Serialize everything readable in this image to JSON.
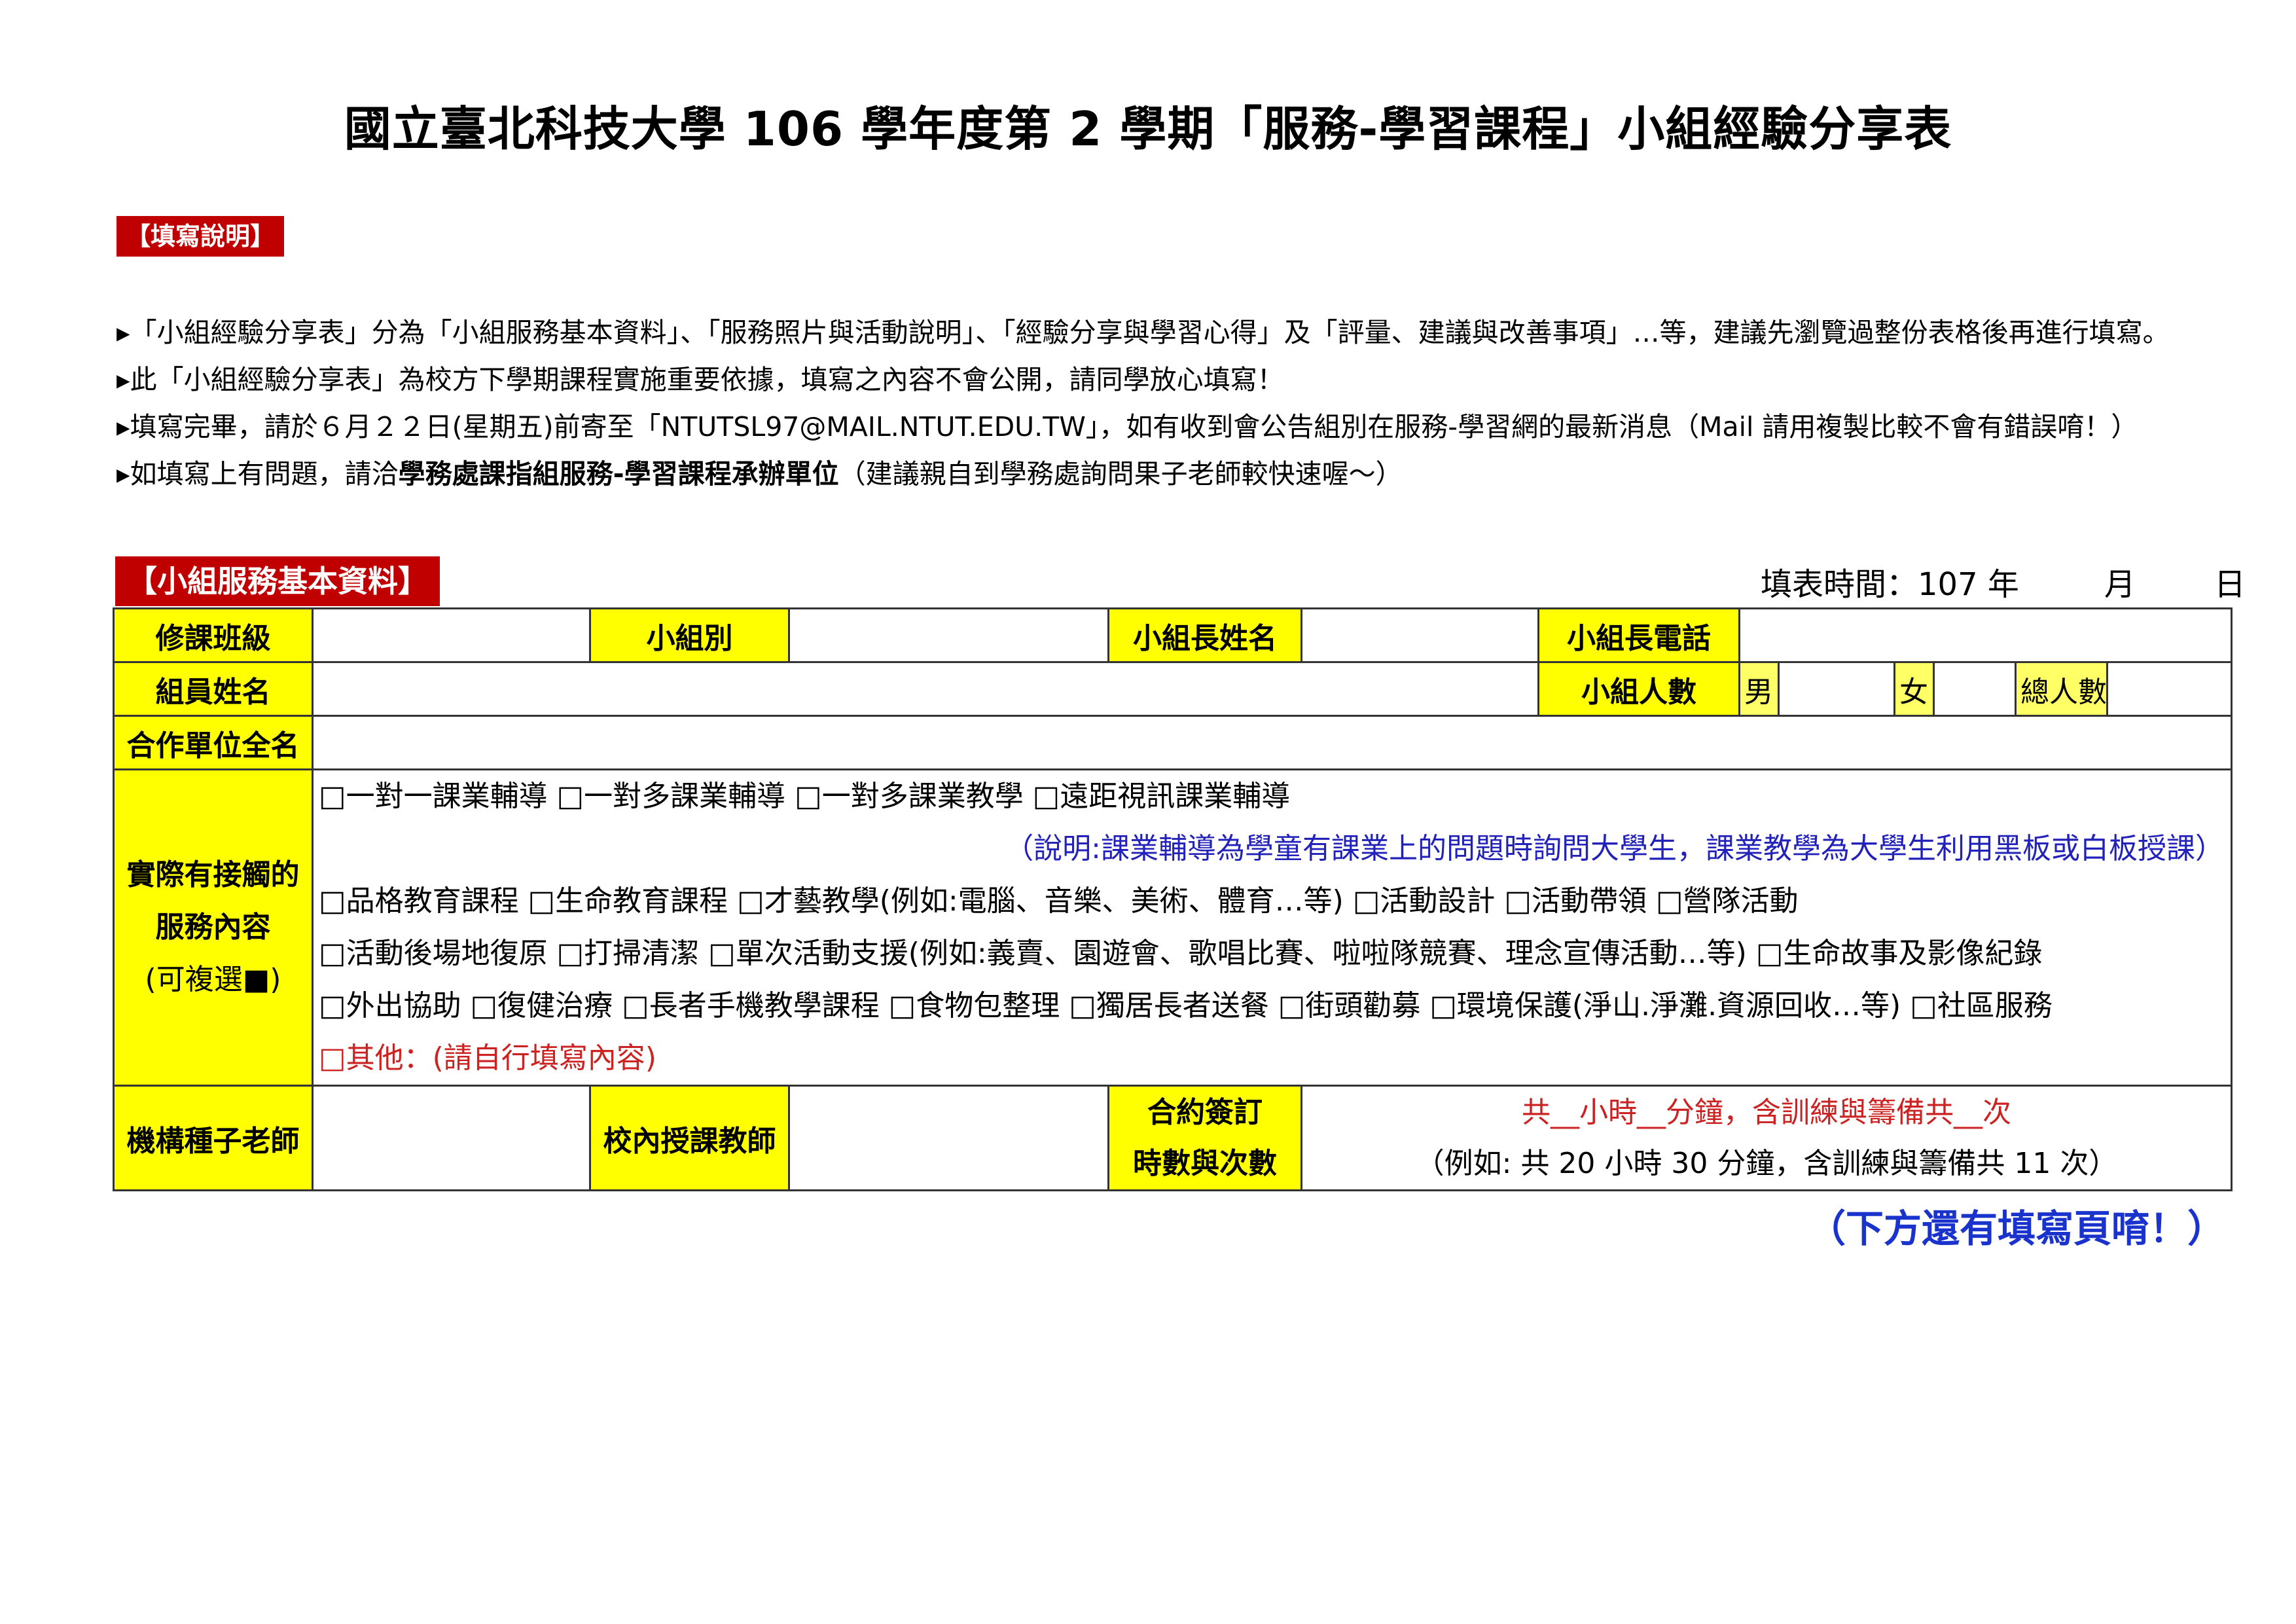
{
  "title": "國立臺北科技大學 106 學年度第 2 學期「服務-學習課程」小組經驗分享表",
  "instructions": {
    "label": "【填寫說明】",
    "lines": [
      "▸「小組經驗分享表」分為「小組服務基本資料」、「服務照片與活動說明」、「經驗分享與學習心得」及「評量、建議與改善事項」…等，建議先瀏覽過整份表格後再進行填寫。",
      "▸此「小組經驗分享表」為校方下學期課程實施重要依據，填寫之內容不會公開，請同學放心填寫！",
      "▸填寫完畢，請於６月２２日(星期五)前寄至「NTUTSL97@MAIL.NTUT.EDU.TW」，如有收到會公告組別在服務-學習網的最新消息（Mail 請用複製比較不會有錯誤唷！）"
    ],
    "line4": {
      "prefix": "▸如填寫上有問題，請洽",
      "bold": "學務處課指組服務-學習課程承辦單位",
      "suffix": "（建議親自到學務處詢問果子老師較快速喔～）"
    }
  },
  "section": {
    "label": "【小組服務基本資料】",
    "fill_time": {
      "prefix": "填表時間：107 年",
      "month": "月",
      "day": "日"
    }
  },
  "form": {
    "course_class": "修課班級",
    "group": "小組別",
    "leader_name": "小組長姓名",
    "leader_phone": "小組長電話",
    "member_names": "組員姓名",
    "group_size": "小組人數",
    "male": "男",
    "female": "女",
    "total": "總人數",
    "partner_full_name": "合作單位全名",
    "service_label": {
      "line1": "實際有接觸的",
      "line2": "服務內容",
      "line3": "(可複選■)"
    },
    "service_lines": [
      "□一對一課業輔導  □一對多課業輔導  □一對多課業教學  □遠距視訊課業輔導",
      "（說明:課業輔導為學童有課業上的問題時詢問大學生，課業教學為大學生利用黑板或白板授課）",
      "□品格教育課程  □生命教育課程  □才藝教學(例如:電腦、音樂、美術、體育…等) □活動設計  □活動帶領  □營隊活動",
      "□活動後場地復原  □打掃清潔  □單次活動支援(例如:義賣、園遊會、歌唱比賽、啦啦隊競賽、理念宣傳活動…等) □生命故事及影像紀錄",
      "□外出協助  □復健治療  □長者手機教學課程  □食物包整理  □獨居長者送餐  □街頭勸募  □環境保護(淨山.淨灘.資源回收…等) □社區服務",
      "□其他：(請自行填寫內容)"
    ],
    "seed_teacher": "機構種子老師",
    "school_teacher": "校內授課教師",
    "contract": {
      "line1": "合約簽訂",
      "line2": "時數與次數"
    },
    "contract_fill": "共__小時__分鐘，含訓練與籌備共__次",
    "contract_example": "（例如: 共 20 小時 30 分鐘，含訓練與籌備共 11 次）"
  },
  "note": "（下方還有填寫頁唷！）",
  "colors": {
    "header_red": "#c00000",
    "label_yellow": "#ffff00",
    "note_blue": "#1a33cc",
    "text_red": "#cc2222"
  }
}
